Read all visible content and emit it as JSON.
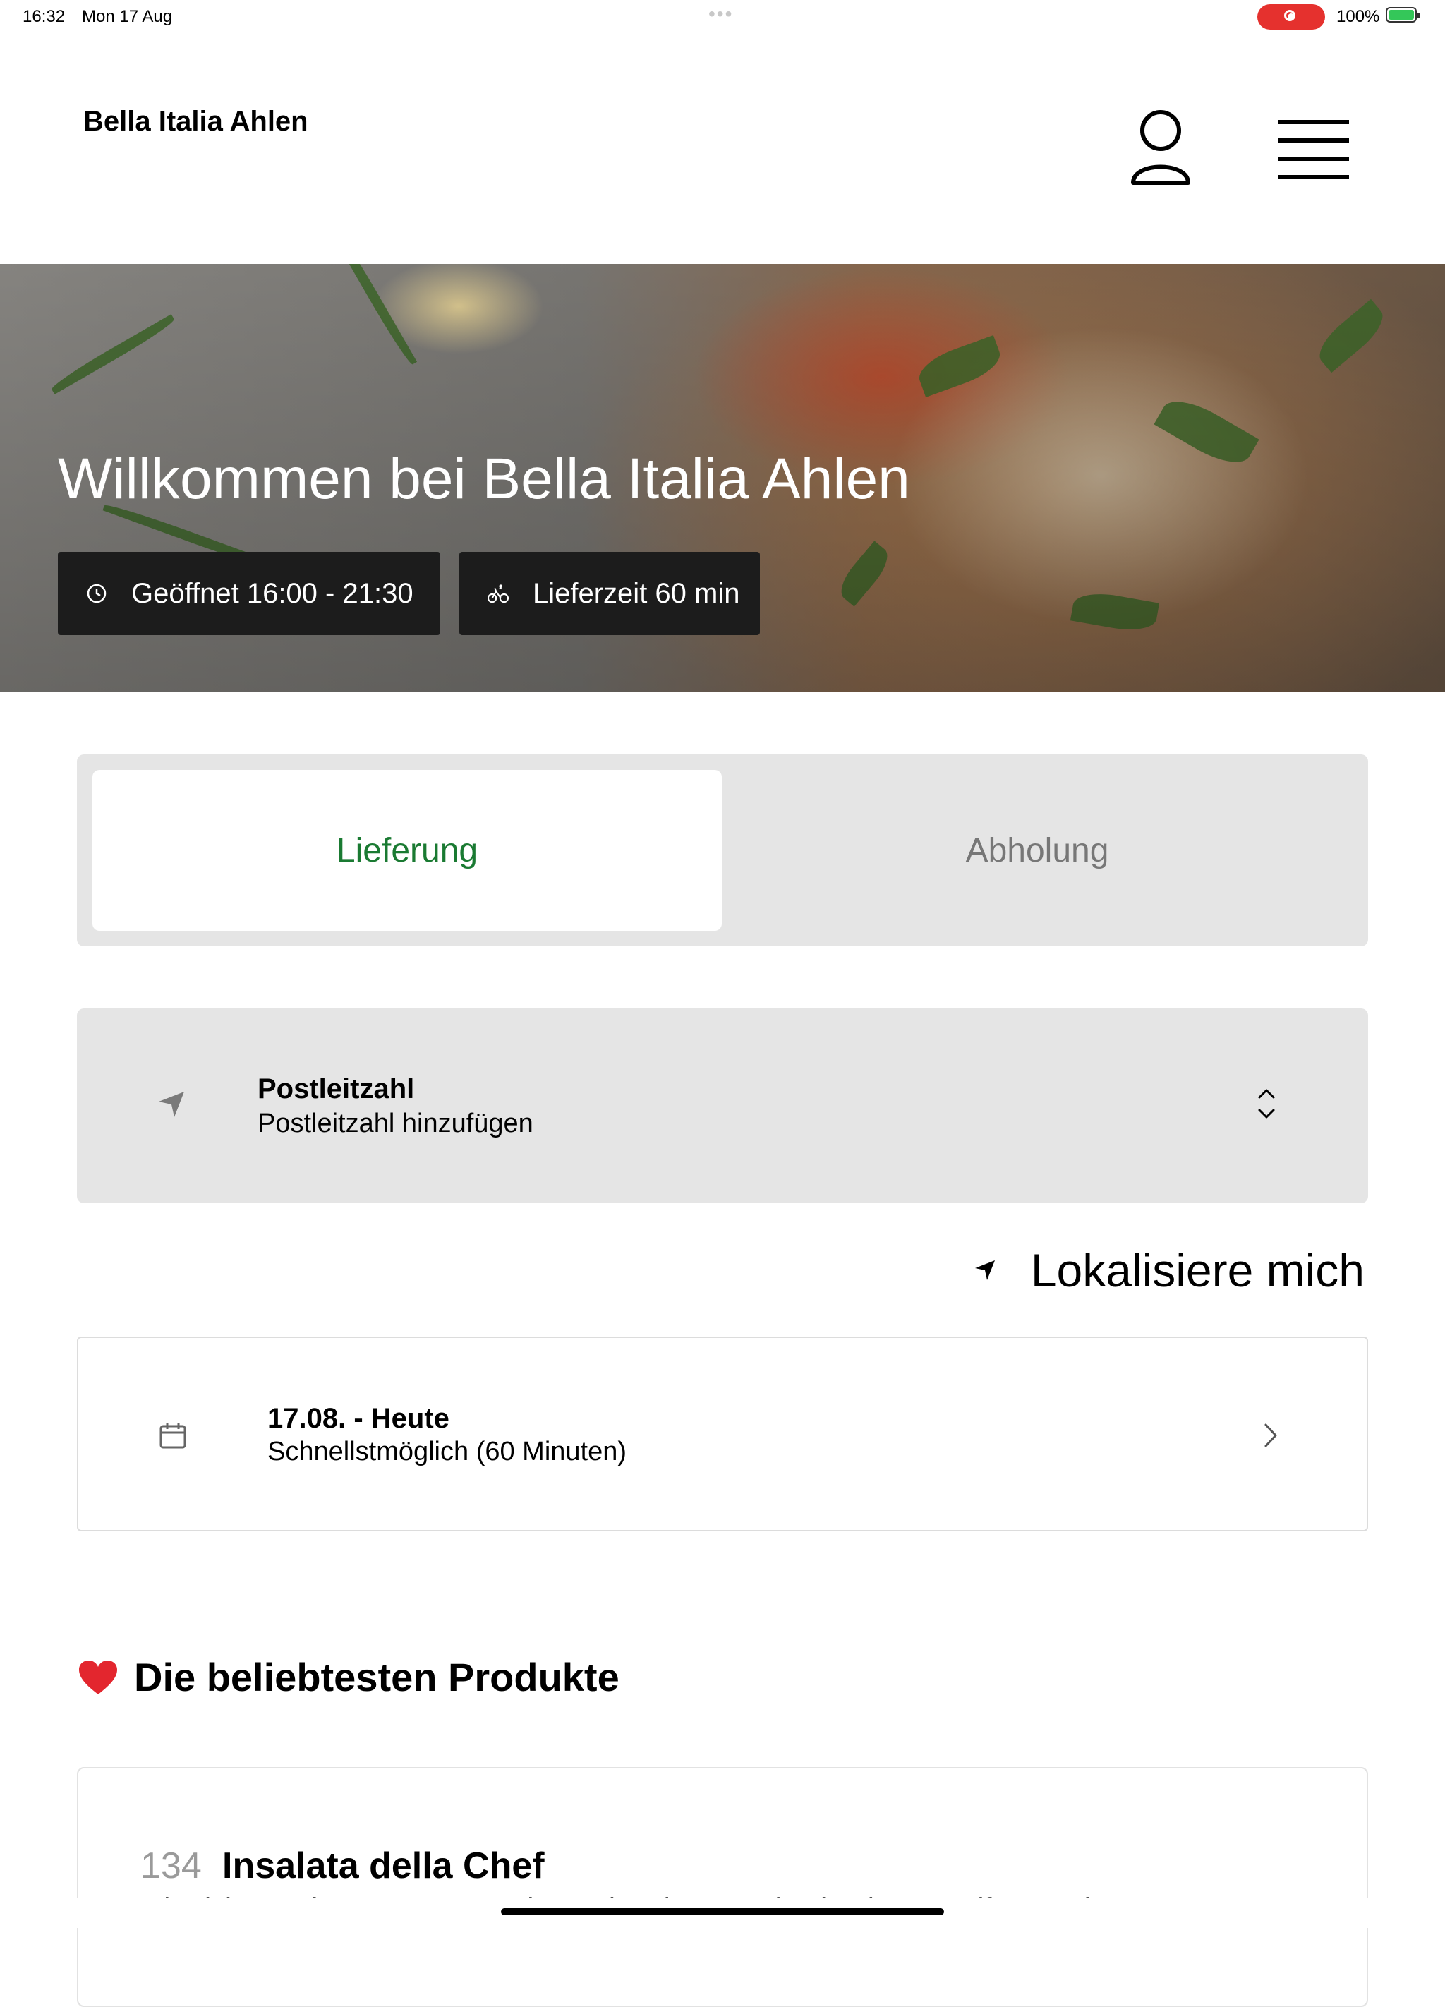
{
  "status_bar": {
    "time": "16:32",
    "date": "Mon 17 Aug",
    "battery": "100%",
    "recording_color": "#e5312e"
  },
  "header": {
    "title": "Bella Italia Ahlen",
    "icons": [
      "user-icon",
      "menu-icon"
    ]
  },
  "hero": {
    "heading": "Willkommen bei Bella Italia Ahlen",
    "opening_hours": "Geöffnet 16:00 - 21:30",
    "delivery_time": "Lieferzeit 60 min"
  },
  "order_type": {
    "options": [
      "Lieferung",
      "Abholung"
    ],
    "selected": "Lieferung",
    "accent_color": "#1a7a32"
  },
  "postcode": {
    "label": "Postleitzahl",
    "placeholder": "Postleitzahl hinzufügen"
  },
  "locate_label": "Lokalisiere mich",
  "delivery_date": {
    "date": "17.08. - Heute",
    "time": "Schnellstmöglich (60 Minuten)"
  },
  "popular": {
    "title": "Die beliebtesten Produkte",
    "products": [
      {
        "number": "134",
        "name": "Insalata della Chef",
        "description": "mit Eisbergsalat, Tomaten, Gurken, Hirtenkäse, Hähnchenbruststreifen, Joghurt-Currysauce"
      }
    ]
  }
}
